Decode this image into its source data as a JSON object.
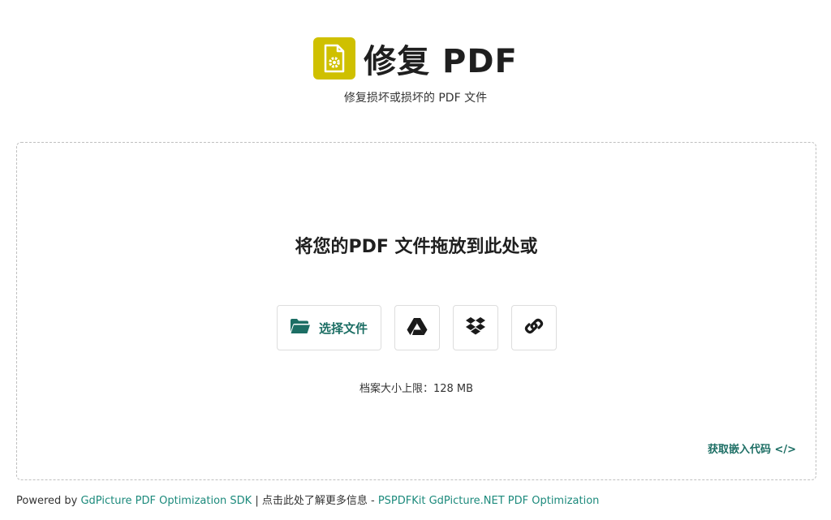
{
  "header": {
    "title": "修复 PDF",
    "subtitle": "修复损坏或损坏的 PDF 文件",
    "logo_icon": "pdf-repair-gear-icon",
    "logo_color": "#cfc000"
  },
  "dropzone": {
    "heading": "将您的PDF 文件拖放到此处或",
    "choose_file_label": "选择文件",
    "choose_file_icon": "folder-open-icon",
    "google_drive_icon": "google-drive-icon",
    "dropbox_icon": "dropbox-icon",
    "link_icon": "link-icon",
    "size_limit": "档案大小上限：128 MB",
    "embed_label": "获取嵌入代码 </>"
  },
  "footer": {
    "powered_by": "Powered by ",
    "sdk_link": "GdPicture PDF Optimization SDK",
    "separator": " | 点击此处了解更多信息 - ",
    "net_link": "PSPDFKit GdPicture.NET PDF Optimization"
  },
  "colors": {
    "accent": "#1c6e64",
    "link": "#1c8a7c",
    "title": "#1f1f1f"
  }
}
